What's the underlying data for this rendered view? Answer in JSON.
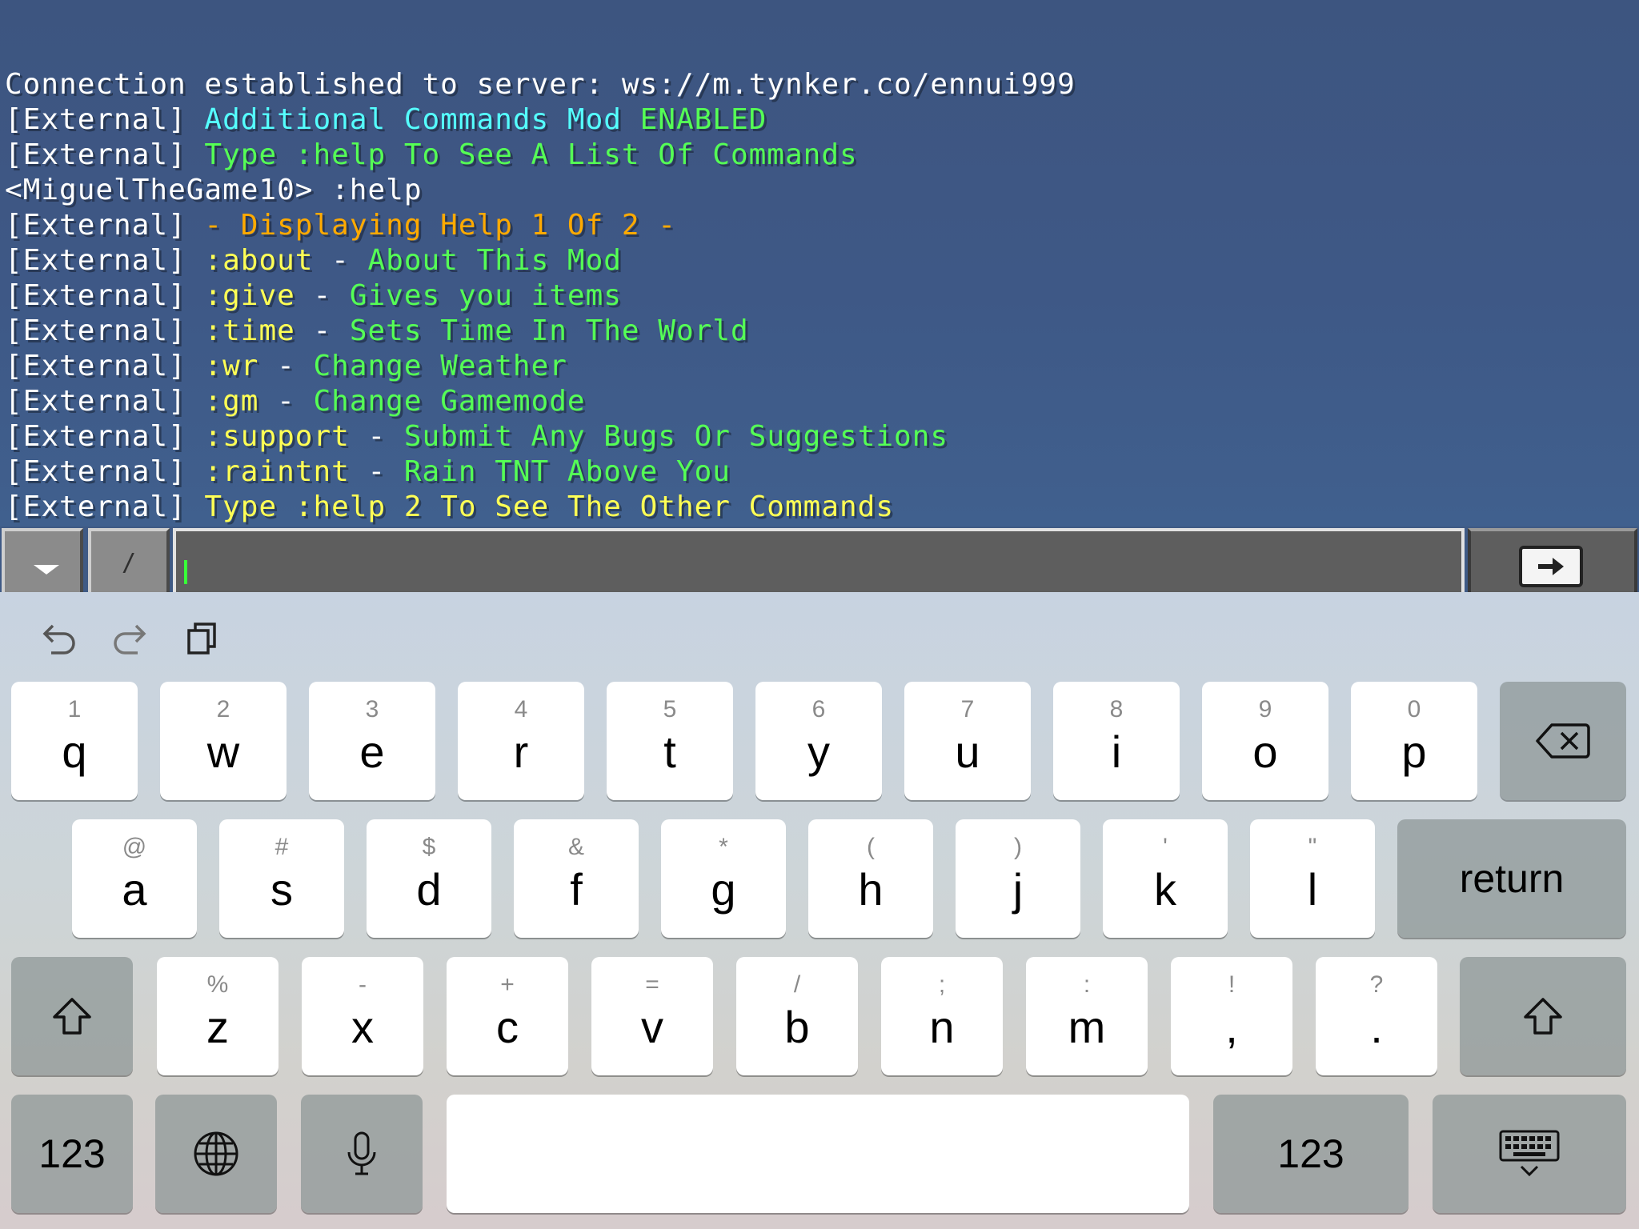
{
  "chat": {
    "lines": [
      [
        {
          "t": "Connection established to server: ws://m.tynker.co/ennui999",
          "c": "#ffffff"
        }
      ],
      [
        {
          "t": "[External] ",
          "c": "#ffffff"
        },
        {
          "t": "Additional Commands Mod ",
          "c": "#55ffff"
        },
        {
          "t": "ENABLED",
          "c": "#55ff55"
        }
      ],
      [
        {
          "t": "[External] ",
          "c": "#ffffff"
        },
        {
          "t": "Type :help To See A List Of Commands",
          "c": "#55ff55"
        }
      ],
      [
        {
          "t": "<MiguelTheGame10> :help",
          "c": "#ffffff"
        }
      ],
      [
        {
          "t": "[External] ",
          "c": "#ffffff"
        },
        {
          "t": "- Displaying Help 1 Of 2 -",
          "c": "#ffaa00"
        }
      ],
      [
        {
          "t": "[External] ",
          "c": "#ffffff"
        },
        {
          "t": ":about",
          "c": "#ffff55"
        },
        {
          "t": " - ",
          "c": "#ffffff"
        },
        {
          "t": "About This Mod",
          "c": "#55ff55"
        }
      ],
      [
        {
          "t": "[External] ",
          "c": "#ffffff"
        },
        {
          "t": ":give",
          "c": "#ffff55"
        },
        {
          "t": " - ",
          "c": "#ffffff"
        },
        {
          "t": "Gives you items",
          "c": "#55ff55"
        }
      ],
      [
        {
          "t": "[External] ",
          "c": "#ffffff"
        },
        {
          "t": ":time",
          "c": "#ffff55"
        },
        {
          "t": " - ",
          "c": "#ffffff"
        },
        {
          "t": "Sets Time In The World",
          "c": "#55ff55"
        }
      ],
      [
        {
          "t": "[External] ",
          "c": "#ffffff"
        },
        {
          "t": ":wr",
          "c": "#ffff55"
        },
        {
          "t": " - ",
          "c": "#ffffff"
        },
        {
          "t": "Change Weather",
          "c": "#55ff55"
        }
      ],
      [
        {
          "t": "[External] ",
          "c": "#ffffff"
        },
        {
          "t": ":gm",
          "c": "#ffff55"
        },
        {
          "t": " - ",
          "c": "#ffffff"
        },
        {
          "t": "Change Gamemode",
          "c": "#55ff55"
        }
      ],
      [
        {
          "t": "[External] ",
          "c": "#ffffff"
        },
        {
          "t": ":support",
          "c": "#ffff55"
        },
        {
          "t": " - ",
          "c": "#ffffff"
        },
        {
          "t": "Submit Any Bugs Or Suggestions",
          "c": "#55ff55"
        }
      ],
      [
        {
          "t": "[External] ",
          "c": "#ffffff"
        },
        {
          "t": ":raintnt",
          "c": "#ffff55"
        },
        {
          "t": " - ",
          "c": "#ffffff"
        },
        {
          "t": "Rain TNT Above You",
          "c": "#55ff55"
        }
      ],
      [
        {
          "t": "[External] ",
          "c": "#ffffff"
        },
        {
          "t": "Type :help 2 To See The Other Commands",
          "c": "#ffff55"
        }
      ]
    ]
  },
  "input_bar": {
    "toggle_icon": "chevron-down-icon",
    "slash_label": "/",
    "input_value": "",
    "send_icon": "arrow-right-icon"
  },
  "keyboard": {
    "shortcuts": {
      "undo_icon": "undo-icon",
      "redo_icon": "redo-icon",
      "paste_icon": "clipboard-icon"
    },
    "row1": [
      {
        "alt": "1",
        "key": "q"
      },
      {
        "alt": "2",
        "key": "w"
      },
      {
        "alt": "3",
        "key": "e"
      },
      {
        "alt": "4",
        "key": "r"
      },
      {
        "alt": "5",
        "key": "t"
      },
      {
        "alt": "6",
        "key": "y"
      },
      {
        "alt": "7",
        "key": "u"
      },
      {
        "alt": "8",
        "key": "i"
      },
      {
        "alt": "9",
        "key": "o"
      },
      {
        "alt": "0",
        "key": "p"
      }
    ],
    "row2": [
      {
        "alt": "@",
        "key": "a"
      },
      {
        "alt": "#",
        "key": "s"
      },
      {
        "alt": "$",
        "key": "d"
      },
      {
        "alt": "&",
        "key": "f"
      },
      {
        "alt": "*",
        "key": "g"
      },
      {
        "alt": "(",
        "key": "h"
      },
      {
        "alt": ")",
        "key": "j"
      },
      {
        "alt": "'",
        "key": "k"
      },
      {
        "alt": "\"",
        "key": "l"
      }
    ],
    "row3": [
      {
        "alt": "%",
        "key": "z"
      },
      {
        "alt": "-",
        "key": "x"
      },
      {
        "alt": "+",
        "key": "c"
      },
      {
        "alt": "=",
        "key": "v"
      },
      {
        "alt": "/",
        "key": "b"
      },
      {
        "alt": ";",
        "key": "n"
      },
      {
        "alt": ":",
        "key": "m"
      },
      {
        "alt": "!",
        "key": ","
      },
      {
        "alt": "?",
        "key": "."
      }
    ],
    "return_label": "return",
    "numbers_label_left": "123",
    "numbers_label_right": "123",
    "space_label": "",
    "icons": {
      "backspace": "backspace-icon",
      "shift": "shift-icon",
      "globe": "globe-icon",
      "mic": "microphone-icon",
      "hide": "keyboard-dismiss-icon"
    }
  }
}
